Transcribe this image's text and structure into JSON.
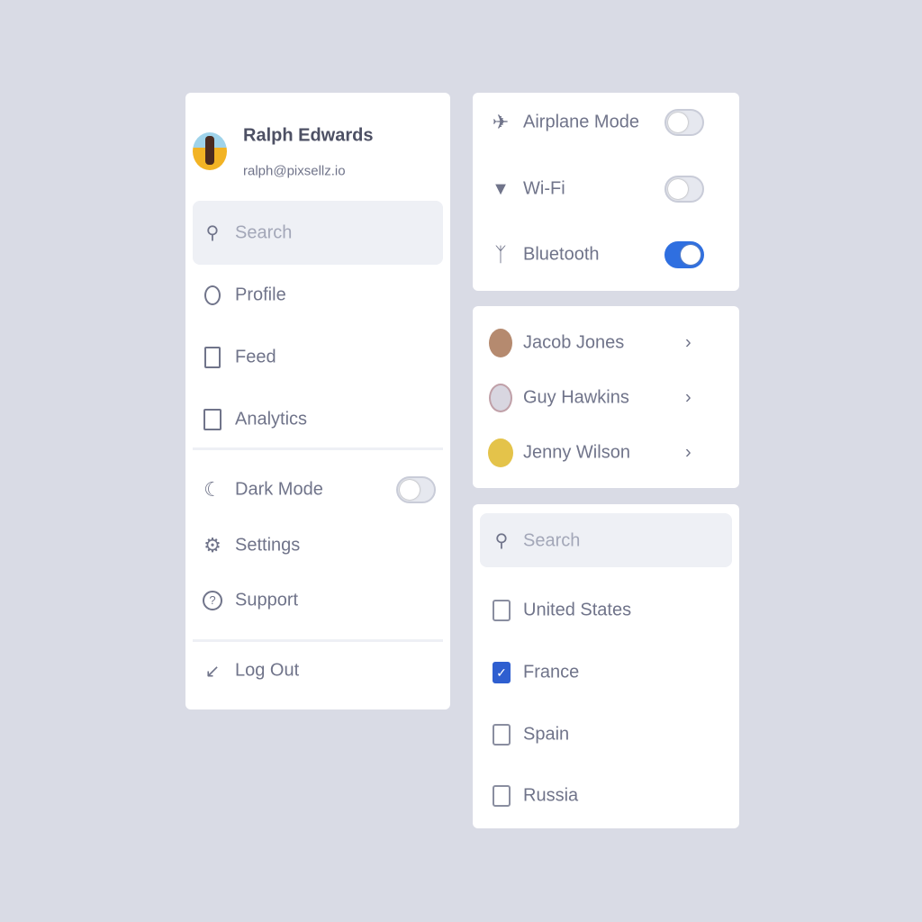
{
  "profile": {
    "name": "Ralph Edwards",
    "email": "ralph@pixsellz.io"
  },
  "menu": {
    "search_placeholder": "Search",
    "items": [
      {
        "label": "Profile",
        "icon": "user-icon"
      },
      {
        "label": "Feed",
        "icon": "feed-icon"
      },
      {
        "label": "Analytics",
        "icon": "analytics-icon"
      }
    ],
    "dark_mode": {
      "label": "Dark Mode",
      "on": false
    },
    "settings": "Settings",
    "support": "Support",
    "logout": "Log Out"
  },
  "connectivity": [
    {
      "label": "Airplane Mode",
      "icon": "airplane-icon",
      "on": false
    },
    {
      "label": "Wi-Fi",
      "icon": "wifi-icon",
      "on": false
    },
    {
      "label": "Bluetooth",
      "icon": "bluetooth-icon",
      "on": true
    }
  ],
  "contacts": [
    {
      "name": "Jacob Jones"
    },
    {
      "name": "Guy Hawkins"
    },
    {
      "name": "Jenny Wilson"
    }
  ],
  "countries": {
    "search_placeholder": "Search",
    "items": [
      {
        "label": "United States",
        "checked": false
      },
      {
        "label": "France",
        "checked": true
      },
      {
        "label": "Spain",
        "checked": false
      },
      {
        "label": "Russia",
        "checked": false
      }
    ]
  },
  "colors": {
    "accent": "#2f6fe0",
    "background": "#d9dbe5"
  }
}
